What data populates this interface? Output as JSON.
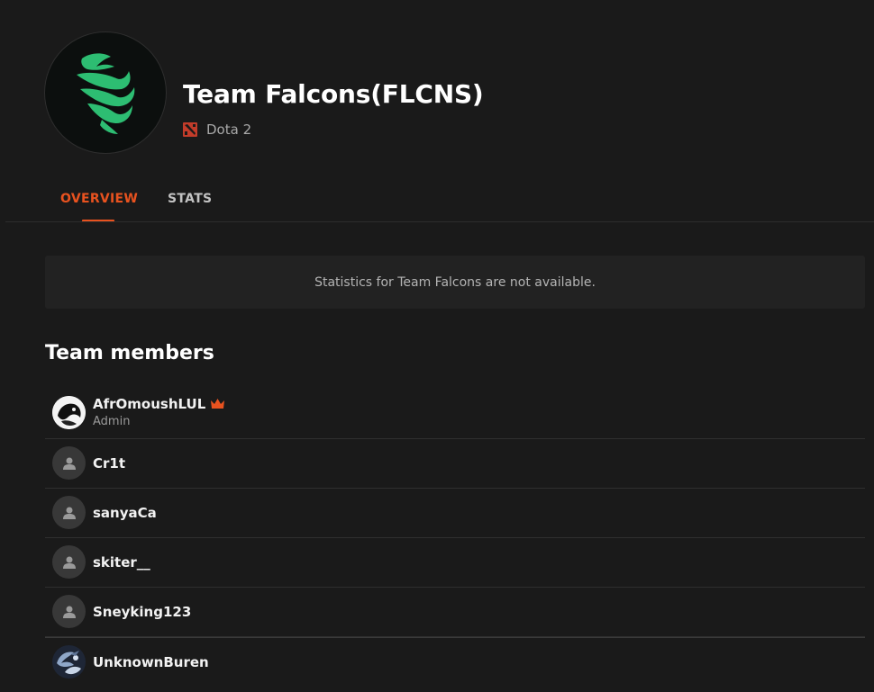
{
  "team": {
    "name": "Team Falcons(FLCNS)",
    "game": "Dota 2",
    "logo_icon": "falcon-logo-icon",
    "logo_color": "#2dbd72"
  },
  "tabs": [
    {
      "label": "OVERVIEW",
      "active": true
    },
    {
      "label": "STATS",
      "active": false
    }
  ],
  "notice": {
    "text": "Statistics for Team Falcons are not available."
  },
  "members": {
    "title": "Team members",
    "items": [
      {
        "name": "AfrOmoushLUL",
        "role": "Admin",
        "avatar": "custom-avatar-dark",
        "badge": "crown-icon"
      },
      {
        "name": "Cr1t",
        "avatar": "default-user-icon"
      },
      {
        "name": "sanyaCa",
        "avatar": "default-user-icon"
      },
      {
        "name": "skiter__",
        "avatar": "default-user-icon"
      },
      {
        "name": "Sneyking123",
        "avatar": "default-user-icon"
      },
      {
        "name": "UnknownBuren",
        "avatar": "custom-avatar-blue"
      }
    ]
  },
  "colors": {
    "accent": "#e8521f",
    "background": "#1a1a1a",
    "panel": "#222222"
  }
}
